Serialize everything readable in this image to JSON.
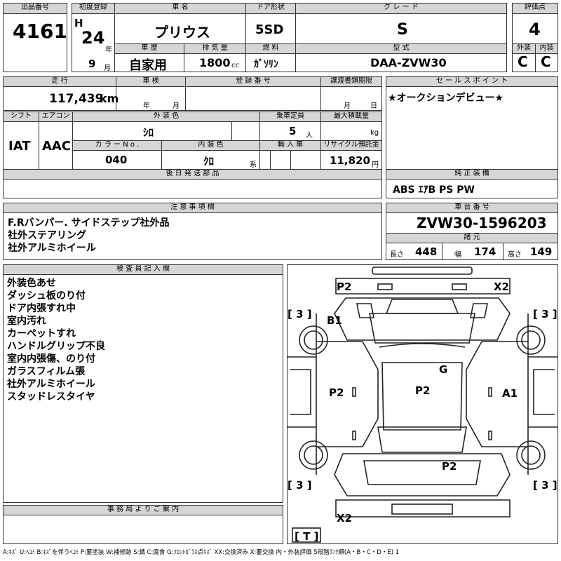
{
  "lot": {
    "label": "出品番号",
    "value": "4161"
  },
  "reg": {
    "label": "初度登録",
    "era": "H",
    "year": "24",
    "year_unit": "年",
    "month": "9",
    "month_unit": "月"
  },
  "name": {
    "label": "車 名",
    "value": "プリウス"
  },
  "door": {
    "label": "ドア形状",
    "value": "5SD"
  },
  "grade": {
    "label": "グ レ ー ド",
    "value": "S"
  },
  "score": {
    "label": "評価点",
    "value": "4"
  },
  "history": {
    "label": "車 歴",
    "value": "自家用"
  },
  "disp": {
    "label": "排 気 量",
    "value": "1800",
    "unit": "cc"
  },
  "fuel": {
    "label": "燃 料",
    "value": "ｶﾞｿﾘﾝ"
  },
  "model": {
    "label": "型 式",
    "value": "DAA-ZVW30"
  },
  "ext": {
    "label": "外装",
    "value": "C"
  },
  "int": {
    "label": "内装",
    "value": "C"
  },
  "mileage": {
    "label": "走 行",
    "value": "117,439",
    "unit": "km"
  },
  "inspect": {
    "label": "車 検",
    "year_unit": "年",
    "month_unit": "月"
  },
  "plate": {
    "label": "登 録 番 号"
  },
  "transfer": {
    "label": "譲渡書類期限",
    "month_unit": "月",
    "day_unit": "日"
  },
  "sales": {
    "label": "セ ー ル ス ポ イ ン ト",
    "value": "★オークションデビュー★"
  },
  "shift": {
    "label": "シフト",
    "value": "IAT"
  },
  "ac": {
    "label": "エアコン",
    "value": "AAC"
  },
  "color": {
    "label": "外 装 色",
    "value": "ｼﾛ"
  },
  "seats": {
    "label": "乗車定員",
    "value": "5",
    "unit": "人"
  },
  "load": {
    "label": "最大積載量",
    "unit": "kg"
  },
  "color_no": {
    "label": "カ ラ ー N o .",
    "value": "040"
  },
  "int_color": {
    "label": "内 装 色",
    "value": "ｸﾛ",
    "unit": "系"
  },
  "import": {
    "label": "輸 入 車"
  },
  "recycle": {
    "label": "リサイクル預託金",
    "value": "11,820",
    "unit": "円"
  },
  "later": {
    "label": "後 日 発 送 部 品"
  },
  "equip": {
    "label": "純 正 装 備",
    "value": "ABS ｴｱB PS PW"
  },
  "notes": {
    "label": "注 意 事 項 欄",
    "lines": [
      "F.Rバンパー. サイドステップ社外品",
      "社外ステアリング",
      "社外アルミホイール"
    ]
  },
  "chassis": {
    "label": "車 台 番 号",
    "value": "ZVW30-1596203"
  },
  "dims": {
    "label": "諸 元",
    "len_label": "長さ",
    "len": "448",
    "wid_label": "幅",
    "wid": "174",
    "hgt_label": "高さ",
    "hgt": "149"
  },
  "inspector": {
    "label": "検 査 員 記 入 欄",
    "lines": [
      "外装色あせ",
      "ダッシュ板のり付",
      "ドア内張すれ中",
      "室内汚れ",
      "カーペットすれ",
      "ハンドルグリップ不良",
      "室内内張傷、のり付",
      "ガラスフィルム張",
      "社外アルミホイール",
      "スタッドレスタイヤ"
    ]
  },
  "office": {
    "label": "事 務 局 よ り ご 案 内"
  },
  "diagram": {
    "marks": [
      "P2",
      "X2",
      "B1",
      "G",
      "P2",
      "P2",
      "A1",
      "P2",
      "X2"
    ],
    "tires": [
      "3",
      "3",
      "3",
      "3"
    ],
    "spare": "T"
  },
  "legend": "A:ｷｽﾞ U:ﾍｺﾐ B:ｷｽﾞを伴うﾍｺﾐ P:要塗装 W:補修跡 S:錆 C:腐食 G:ﾌﾛﾝﾄｶﾞﾗｽ点ｷｽﾞ XX:交換済み X:要交換 内・外装評価 5段階ﾗﾝｸ順(A・B・C・D・E) 1"
}
